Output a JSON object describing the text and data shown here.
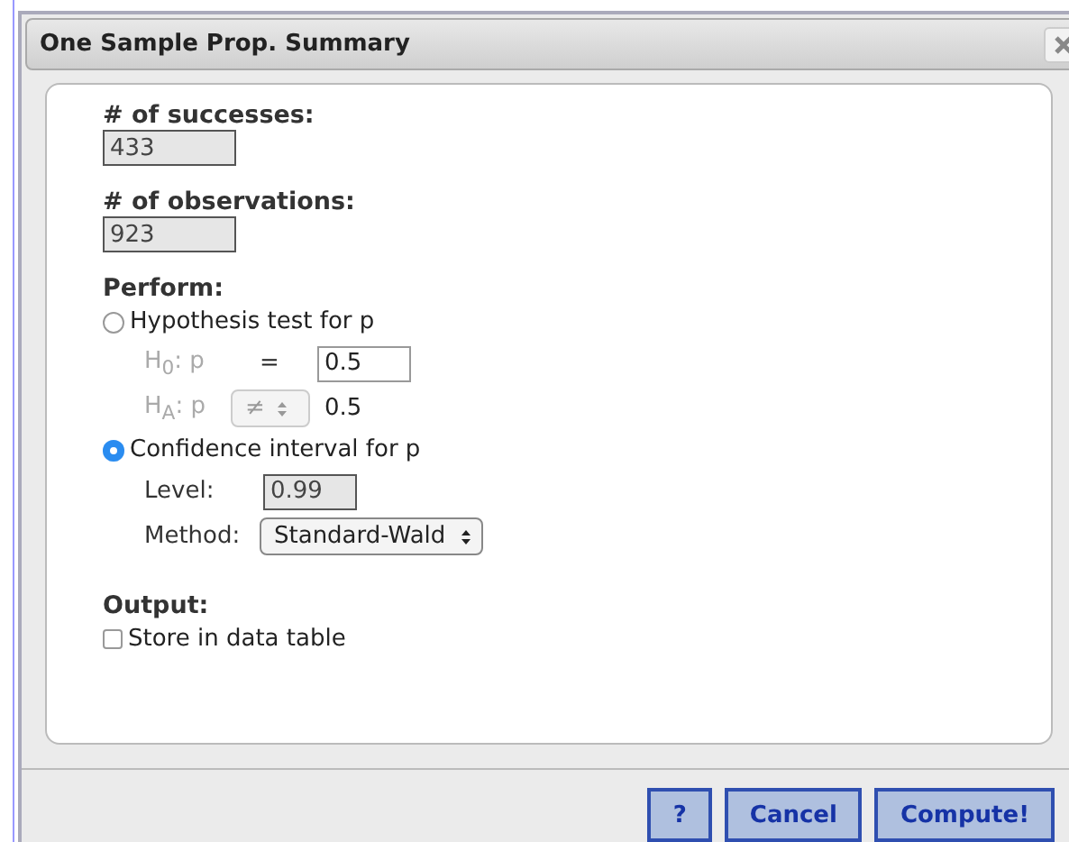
{
  "window": {
    "title": "One Sample Prop. Summary"
  },
  "fields": [
    {
      "label": "# of successes:",
      "value": "433"
    },
    {
      "label": "# of observations:",
      "value": "923"
    }
  ],
  "perform": {
    "label": "Perform:",
    "options": [
      {
        "kind": "hypothesis",
        "label": "Hypothesis test for p",
        "selected": false,
        "null_label": "H$_{0}$: p",
        "null_operator": "=",
        "null_value": "0.5",
        "alt_label": "H$_{A}$: p",
        "alt_operator": "≠",
        "alt_value": "0.5"
      },
      {
        "kind": "interval",
        "label": "Confidence interval for p",
        "selected": true,
        "level_label": "Level:",
        "level_value": "0.99",
        "method_label": "Method:",
        "method": "Standard-Wald"
      }
    ]
  },
  "output": {
    "label": "Output:",
    "options": [
      {
        "label": "Store in data table",
        "checked": false
      }
    ]
  },
  "buttons": [
    {
      "label": "?"
    },
    {
      "label": "Cancel"
    },
    {
      "label": "Compute!"
    }
  ]
}
